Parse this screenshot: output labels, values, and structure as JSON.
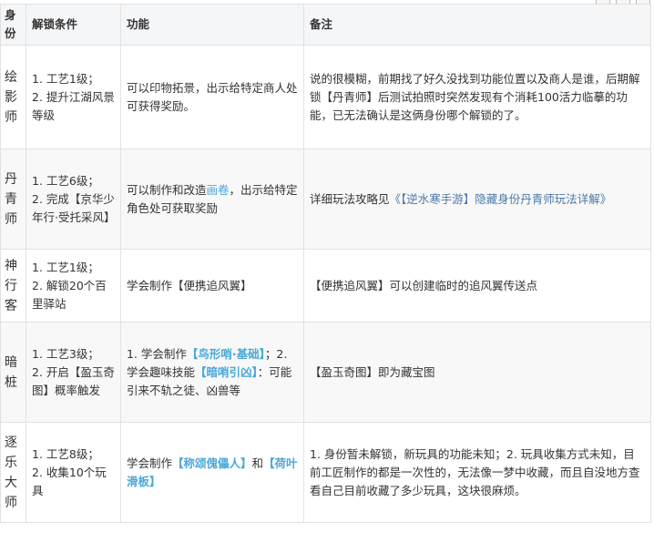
{
  "headers": {
    "identity": "身份",
    "condition": "解锁条件",
    "function": "功能",
    "notes": "备注"
  },
  "rows": [
    {
      "name": "绘影师",
      "cond": [
        "1. 工艺1级；",
        "2. 提升江湖风景等级"
      ],
      "func_text": "可以印物拓景，出示给特定商人处可获得奖励。",
      "notes_text": "说的很模糊，前期找了好久没找到功能位置以及商人是谁，后期解锁【丹青师】后测试拍照时突然发现有个消耗100活力临摹的功能，已无法确认是这俩身份哪个解锁的了。"
    },
    {
      "name": "丹青师",
      "cond": [
        "1. 工艺6级；",
        "2. 完成【京华少年行·受托采风】"
      ],
      "func_pre": "可以制作和改造",
      "func_hl": "画卷",
      "func_post": "，出示给特定角色处可获取奖励",
      "notes_pre": "详细玩法攻略见",
      "notes_link": "《【逆水寒手游】隐藏身份丹青师玩法详解》"
    },
    {
      "name": "神行客",
      "cond": [
        "1. 工艺1级；",
        "2. 解锁20个百里驿站"
      ],
      "func_text": "学会制作【便携追风翼】",
      "notes_text": "【便携追风翼】可以创建临时的追风翼传送点"
    },
    {
      "name": "暗桩",
      "cond": [
        "1. 工艺3级；",
        "2. 开启【盈玉奇图】概率触发"
      ],
      "func_a": "1. 学会制作",
      "func_hl1": "【鸟形哨·基础】",
      "func_b": "；2. 学会趣味技能",
      "func_hl2": "【暗哨引凶】",
      "func_c": "：可能引来不轨之徒、凶兽等",
      "notes_text": "【盈玉奇图】即为藏宝图"
    },
    {
      "name": "逐乐大师",
      "cond": [
        "1. 工艺8级；",
        "2. 收集10个玩具"
      ],
      "func_a": "学会制作",
      "func_hl1": "【称颂傀儡人】",
      "func_b": "和",
      "func_hl2": "【荷叶滑板】",
      "notes_text": "1. 身份暂未解锁，新玩具的功能未知；2. 玩具收集方式未知，目前工匠制作的都是一次性的，无法像一梦中收藏，而且自没地方查看自己目前收藏了多少玩具，这块很麻烦。"
    }
  ]
}
